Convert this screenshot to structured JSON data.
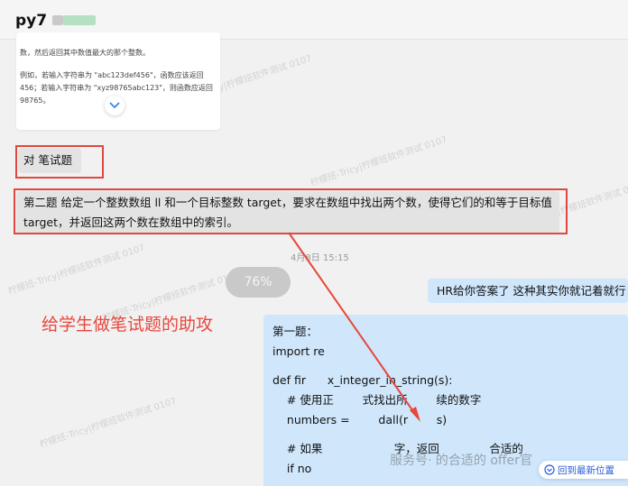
{
  "header": {
    "title": "py7"
  },
  "card": {
    "line1": "数，然后返回其中数值最大的那个整数。",
    "line2": "例如，若输入字符串为 \"abc123def456\"，函数应该返回 456；若输入字符串为 \"xyz98765abc123\"，则函数应返回 98765。",
    "chevron_icon": "chevron-down-icon"
  },
  "messages": {
    "msg1": "对 笔试题",
    "msg2": "第二题 给定一个整数数组 ll 和一个目标整数 target，要求在数组中找出两个数，使得它们的和等于目标值 target，并返回这两个数在数组中的索引。",
    "timestamp": "4月8日 15:15",
    "progress": "76%",
    "reply1": "HR给你答案了 这种其实你就记着就行",
    "code_lines": [
      "第一题：",
      "import re",
      "",
      "def fir      x_integer_in_string(s):",
      "    # 使用正        式找出所        续的数字",
      "    numbers =        dall(r        s)",
      "",
      "    # 如果                    字，返回              合适的",
      "    if no"
    ]
  },
  "annotation": "给学生做笔试题的助攻",
  "watermark": "柠檬班-Tricy|柠檬班软件测试 0107",
  "footer": {
    "brand_watermark": "服务号·            的合适的 offer官",
    "scroll_button": "回到最新位置"
  },
  "colors": {
    "annotation_red": "#e8473d",
    "bubble_blue": "#cfe6fb",
    "bubble_gray": "#e3e3e3",
    "link_blue": "#2a5bd7"
  }
}
